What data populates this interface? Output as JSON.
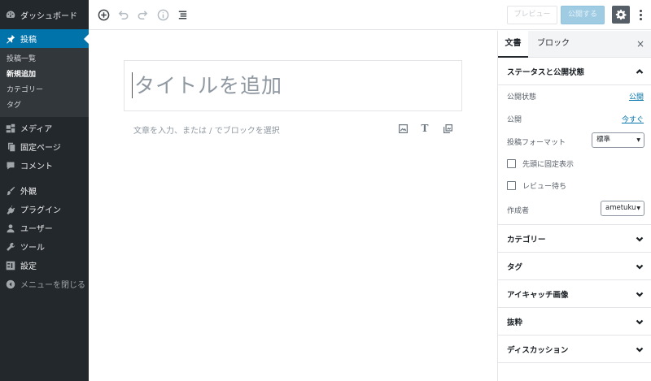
{
  "admin_menu": {
    "dashboard": "ダッシュボード",
    "posts": "投稿",
    "posts_sub": [
      "投稿一覧",
      "新規追加",
      "カテゴリー",
      "タグ"
    ],
    "media": "メディア",
    "pages": "固定ページ",
    "comments": "コメント",
    "appearance": "外観",
    "plugins": "プラグイン",
    "users": "ユーザー",
    "tools": "ツール",
    "settings": "設定",
    "collapse": "メニューを閉じる"
  },
  "toolbar": {
    "preview_label": "プレビュー",
    "publish_label": "公開する"
  },
  "editor": {
    "title_placeholder": "タイトルを追加",
    "paragraph_placeholder": "文章を入力、または / でブロックを選択",
    "text_block_glyph": "T"
  },
  "settings_sidebar": {
    "tab_document": "文書",
    "tab_block": "ブロック",
    "close_glyph": "×",
    "status_panel": {
      "title": "ステータスと公開状態",
      "visibility_label": "公開状態",
      "visibility_value": "公開",
      "publish_label": "公開",
      "publish_value": "今すぐ",
      "format_label": "投稿フォーマット",
      "format_value": "標準",
      "sticky_label": "先頭に固定表示",
      "pending_label": "レビュー待ち",
      "author_label": "作成者",
      "author_value": "ametuku",
      "select_arrow": "▼"
    },
    "panels": [
      "カテゴリー",
      "タグ",
      "アイキャッチ画像",
      "抜粋",
      "ディスカッション"
    ]
  },
  "colors": {
    "sidebar_bg": "#23282d",
    "submenu_bg": "#32373c",
    "accent": "#0073aa",
    "publish_disabled": "#9fcbe3"
  }
}
